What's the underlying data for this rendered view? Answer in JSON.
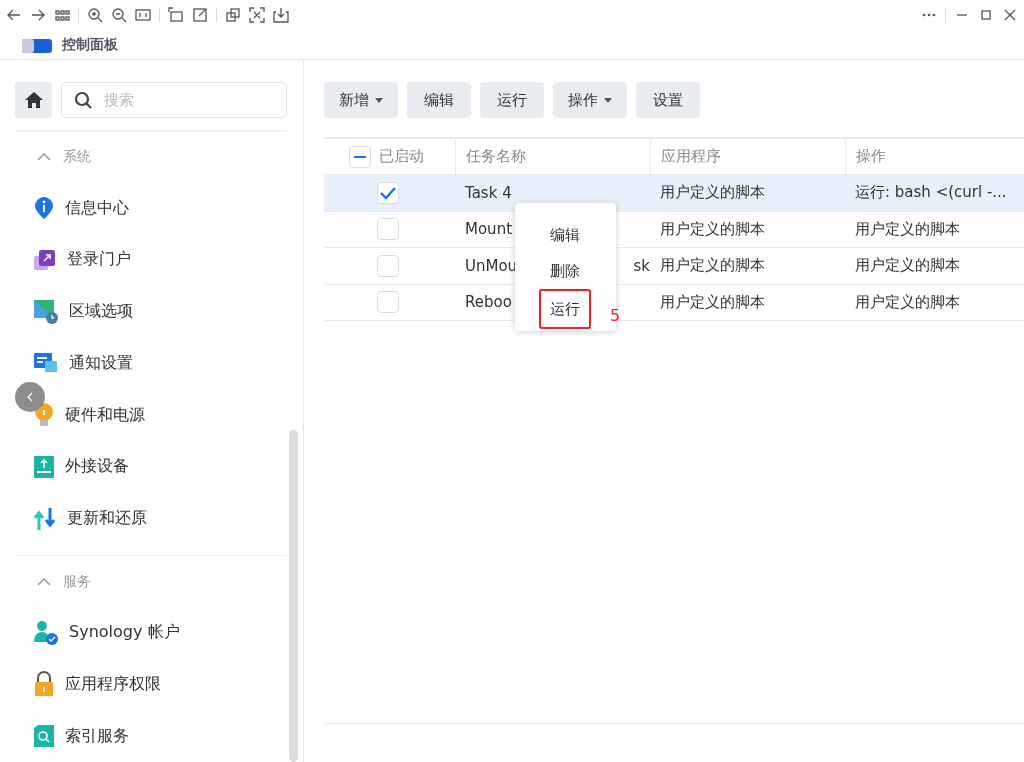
{
  "app_title": "控制面板",
  "sidebar": {
    "search": {
      "placeholder": "搜索"
    },
    "sections": [
      {
        "title": "系统",
        "items": [
          {
            "label": "信息中心"
          },
          {
            "label": "登录门户"
          },
          {
            "label": "区域选项"
          },
          {
            "label": "通知设置"
          },
          {
            "label": "硬件和电源"
          },
          {
            "label": "外接设备"
          },
          {
            "label": "更新和还原"
          }
        ]
      },
      {
        "title": "服务",
        "items": [
          {
            "label": "Synology 帐户"
          },
          {
            "label": "应用程序权限"
          },
          {
            "label": "索引服务"
          }
        ]
      }
    ]
  },
  "toolbar": [
    {
      "label": "新增",
      "dropdown": true
    },
    {
      "label": "编辑",
      "dropdown": false
    },
    {
      "label": "运行",
      "dropdown": false
    },
    {
      "label": "操作",
      "dropdown": true
    },
    {
      "label": "设置",
      "dropdown": false
    }
  ],
  "table": {
    "header_partial": true,
    "columns": [
      "已启动",
      "任务名称",
      "应用程序",
      "操作"
    ],
    "rows": [
      {
        "checked": true,
        "selected": true,
        "name": "Task 4",
        "app": "用户定义的脚本",
        "action": "运行: bash <(curl -..."
      },
      {
        "checked": false,
        "selected": false,
        "name": "Mount",
        "app": "用户定义的脚本",
        "action": "用户定义的脚本"
      },
      {
        "checked": false,
        "selected": false,
        "name": "UnMou",
        "name_end": "sk",
        "app": "用户定义的脚本",
        "action": "用户定义的脚本"
      },
      {
        "checked": false,
        "selected": false,
        "name": "Reboo",
        "app": "用户定义的脚本",
        "action": "用户定义的脚本"
      }
    ]
  },
  "context_menu": [
    {
      "label": "编辑",
      "highlighted": false
    },
    {
      "label": "删除",
      "highlighted": false
    },
    {
      "label": "运行",
      "highlighted": true
    }
  ],
  "step_marker": "5"
}
